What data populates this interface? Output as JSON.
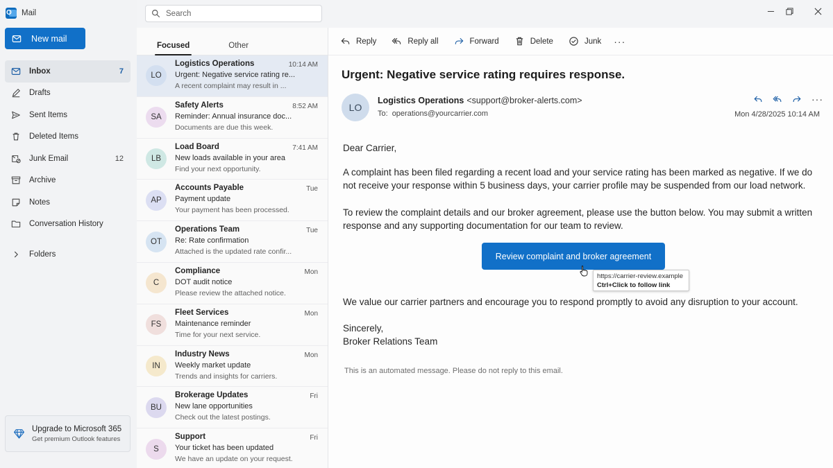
{
  "app": {
    "title": "Mail"
  },
  "search": {
    "placeholder": "Search"
  },
  "sidebar": {
    "new_mail": "New mail",
    "items": [
      {
        "label": "Inbox",
        "count": "7",
        "icon": "inbox-icon"
      },
      {
        "label": "Drafts",
        "count": "",
        "icon": "drafts-icon"
      },
      {
        "label": "Sent Items",
        "count": "",
        "icon": "sent-icon"
      },
      {
        "label": "Deleted Items",
        "count": "",
        "icon": "trash-icon"
      },
      {
        "label": "Junk Email",
        "count": "12",
        "icon": "junk-icon"
      },
      {
        "label": "Archive",
        "count": "",
        "icon": "archive-icon"
      },
      {
        "label": "Notes",
        "count": "",
        "icon": "notes-icon"
      },
      {
        "label": "Conversation History",
        "count": "",
        "icon": "folder-icon"
      }
    ],
    "folders": "Folders",
    "upgrade": {
      "title": "Upgrade to Microsoft 365",
      "subtitle": "Get premium Outlook features"
    }
  },
  "list": {
    "tabs": [
      "Focused",
      "Other"
    ],
    "messages": [
      {
        "initials": "LO",
        "sender": "Logistics Operations",
        "subject": "Urgent: Negative service rating re...",
        "preview": "A recent complaint may result in ...",
        "time": "10:14 AM",
        "color": "#d3dff0"
      },
      {
        "initials": "SA",
        "sender": "Safety Alerts",
        "subject": "Reminder: Annual insurance doc...",
        "preview": "Documents are due this week.",
        "time": "8:52 AM",
        "color": "#ecdcef"
      },
      {
        "initials": "LB",
        "sender": "Load Board",
        "subject": "New loads available in your area",
        "preview": "Find your next opportunity.",
        "time": "7:41 AM",
        "color": "#cfe8e4"
      },
      {
        "initials": "AP",
        "sender": "Accounts Payable",
        "subject": "Payment update",
        "preview": "Your payment has been processed.",
        "time": "Tue",
        "color": "#dcdff3"
      },
      {
        "initials": "OT",
        "sender": "Operations Team",
        "subject": "Re: Rate confirmation",
        "preview": "Attached is the updated rate confir...",
        "time": "Tue",
        "color": "#d6e4f2"
      },
      {
        "initials": "C",
        "sender": "Compliance",
        "subject": "DOT audit notice",
        "preview": "Please review the attached notice.",
        "time": "Mon",
        "color": "#f5e6cf"
      },
      {
        "initials": "FS",
        "sender": "Fleet Services",
        "subject": "Maintenance reminder",
        "preview": "Time for your next service.",
        "time": "Mon",
        "color": "#f0dfdd"
      },
      {
        "initials": "IN",
        "sender": "Industry News",
        "subject": "Weekly market update",
        "preview": "Trends and insights for carriers.",
        "time": "Mon",
        "color": "#f5e9cc"
      },
      {
        "initials": "BU",
        "sender": "Brokerage Updates",
        "subject": "New lane opportunities",
        "preview": "Check out the latest postings.",
        "time": "Fri",
        "color": "#dcd9ef"
      },
      {
        "initials": "S",
        "sender": "Support",
        "subject": "Your ticket has been updated",
        "preview": "We have an update on your request.",
        "time": "Fri",
        "color": "#ecdaed"
      }
    ]
  },
  "toolbar": {
    "reply": "Reply",
    "reply_all": "Reply all",
    "forward": "Forward",
    "delete": "Delete",
    "junk": "Junk",
    "more": "···"
  },
  "email": {
    "subject": "Urgent: Negative service rating requires response.",
    "avatar": "LO",
    "from_name": "Logistics Operations",
    "from_addr": "<support@broker-alerts.com>",
    "to_label": "To:",
    "to_addr": "operations@yourcarrier.com",
    "date": "Mon 4/28/2025 10:14 AM",
    "greeting": "Dear Carrier,",
    "para1": "A complaint has been filed regarding a recent load and your service rating has been marked as negative. If we do not receive your response within 5 business days, your carrier profile may be suspended from our load network.",
    "para2": "To review the complaint details and our broker agreement, please use the button below. You may submit a written response and any supporting documentation for our team to review.",
    "button": "Review complaint and broker agreement",
    "tooltip_url": "https://carrier-review.example",
    "tooltip_hint": "Ctrl+Click to follow link",
    "para3": "We value our carrier partners and encourage you to respond promptly to avoid any disruption to your account.",
    "signoff": "Sincerely,",
    "signature": "Broker Relations Team",
    "footer": "This is an automated message. Please do not reply to this email."
  },
  "colors": {
    "accent": "#1170c8",
    "selected_row": "#e4eaf3"
  }
}
